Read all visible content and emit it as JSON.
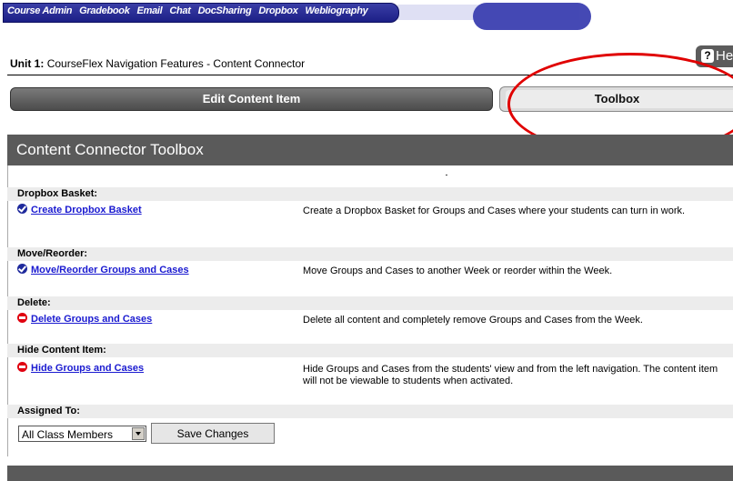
{
  "topnav": {
    "items": [
      "Course Admin",
      "Gradebook",
      "Email",
      "Chat",
      "DocSharing",
      "Dropbox",
      "Webliography"
    ]
  },
  "unit": {
    "label": "Unit 1:",
    "title": "CourseFlex Navigation Features - Content Connector"
  },
  "help": {
    "label": "Hel"
  },
  "tabs": {
    "edit": "Edit Content Item",
    "toolbox": "Toolbox"
  },
  "section": {
    "title": "Content Connector Toolbox"
  },
  "rows": [
    {
      "category": "Dropbox Basket:",
      "link": "Create Dropbox Basket",
      "icon": "check-icon",
      "desc": "Create a Dropbox Basket for Groups and Cases where your students can turn in work."
    },
    {
      "category": "Move/Reorder:",
      "link": "Move/Reorder Groups and Cases",
      "icon": "check-icon",
      "desc": "Move Groups and Cases to another Week or reorder within the Week."
    },
    {
      "category": "Delete:",
      "link": "Delete Groups and Cases",
      "icon": "minus-icon",
      "desc": "Delete all content and completely remove Groups and Cases from the Week."
    },
    {
      "category": "Hide Content Item:",
      "link": "Hide Groups and Cases",
      "icon": "minus-icon",
      "desc": "Hide Groups and Cases from the students' view and from the left navigation. The content item will not be viewable to students when activated."
    }
  ],
  "assigned": {
    "label": "Assigned To:",
    "select_value": "All Class Members",
    "save_label": "Save Changes"
  },
  "colors": {
    "annotation_circle": "#e00000",
    "link": "#1a1ad0",
    "header_bg": "#5a5a5a"
  }
}
